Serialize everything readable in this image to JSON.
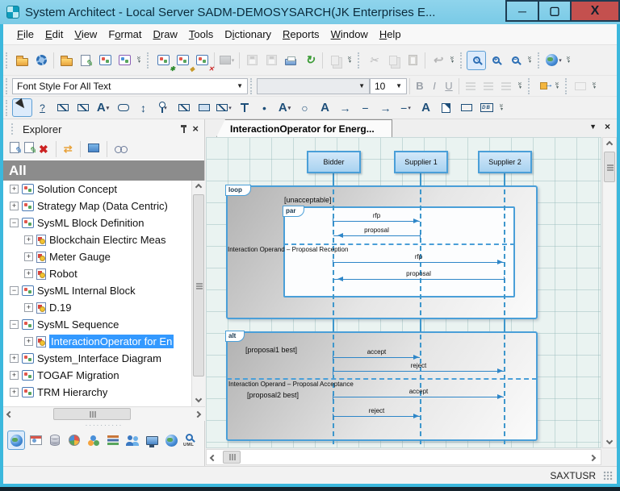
{
  "window": {
    "title": "System Architect - Local Server SADM-DEMOSYSARCH(JK Enterprises E..."
  },
  "menu_bar": {
    "items": [
      {
        "label": "File",
        "u": 0
      },
      {
        "label": "Edit",
        "u": 0
      },
      {
        "label": "View",
        "u": 0
      },
      {
        "label": "Format",
        "u": 1
      },
      {
        "label": "Draw",
        "u": 0
      },
      {
        "label": "Tools",
        "u": 0
      },
      {
        "label": "Dictionary",
        "u": 1
      },
      {
        "label": "Reports",
        "u": 0
      },
      {
        "label": "Window",
        "u": 0
      },
      {
        "label": "Help",
        "u": 0
      }
    ]
  },
  "toolbars": {
    "standard_icons": [
      "open",
      "options",
      "copy-definition",
      "edit-definition",
      "diagram-catalog",
      "diagram-grid"
    ],
    "diagram_icons": [
      "new-diagram",
      "add-diagram",
      "delete-diagram",
      "insert-image",
      "save",
      "save-all",
      "print",
      "refresh-diagram",
      "export-window"
    ],
    "edit_icons": [
      "cut",
      "copy",
      "paste",
      "undo"
    ],
    "zoom_icons": [
      "zoom-region",
      "zoom-in",
      "zoom-out"
    ],
    "web_icons": [
      "web-publish"
    ],
    "draw_icons": [
      "select-pointer",
      "comment",
      "shape-diagonal",
      "shape-diagonal-2",
      "text",
      "rounded-rect",
      "vertical-spacing",
      "lifeline",
      "shape",
      "rectangle",
      "shape-menu",
      "connector-pin",
      "point",
      "text-2",
      "ellipse",
      "text-3",
      "arrow-line",
      "line",
      "arrow-line-2",
      "line-menu",
      "text-4",
      "note",
      "rectangle-2",
      "database-symbol"
    ],
    "font_toolbar": {
      "style_value": "Font Style For All Text",
      "font_value": "",
      "size_value": "10",
      "bold": "B",
      "italic": "I",
      "underline": "U"
    }
  },
  "explorer": {
    "title": "Explorer",
    "toolbar_icons": [
      "new-definition",
      "edit-definition",
      "delete",
      "sync",
      "preview",
      "browse"
    ],
    "filter_header": "All",
    "tree": [
      {
        "label": "Solution Concept"
      },
      {
        "label": "Strategy Map (Data Centric)"
      },
      {
        "label": "SysML Block Definition"
      },
      {
        "label": "Blockchain Electirc Meas"
      },
      {
        "label": "Meter Gauge"
      },
      {
        "label": "Robot"
      },
      {
        "label": "SysML Internal Block"
      },
      {
        "label": "D.19"
      },
      {
        "label": "SysML Sequence"
      },
      {
        "label": "InteractionOperator for En"
      },
      {
        "label": "System_Interface Diagram"
      },
      {
        "label": "TOGAF Migration"
      },
      {
        "label": "TRM Hierarchy"
      }
    ],
    "bottom_toolbar_icons": [
      "all-view",
      "process-view",
      "data-view",
      "business-view",
      "object-view",
      "catalog-view",
      "users-view",
      "infrastructure-view",
      "web-view",
      "uml-search",
      "more-views"
    ]
  },
  "document": {
    "tab_title": "InteractionOperator for Energ..."
  },
  "diagram": {
    "lifelines": [
      {
        "name": "Bidder"
      },
      {
        "name": "Supplier 1"
      },
      {
        "name": "Supplier 2"
      }
    ],
    "loop": {
      "operator": "loop",
      "guard": "[unacceptable]",
      "par_operator": "par",
      "rfp1": "rfp",
      "proposal1": "proposal",
      "separator": "Interaction Operand – Proposal Reception",
      "rfp2": "rfp",
      "proposal2": "proposal"
    },
    "alt": {
      "operator": "alt",
      "guard1": "[proposal1 best]",
      "accept1": "accept",
      "reject1": "reject",
      "separator": "Interaction Operand  – Proposal Acceptance",
      "guard2": "[proposal2 best]",
      "accept2": "accept",
      "reject2": "reject"
    }
  },
  "status_bar": {
    "user": "SAXTUSR"
  },
  "colors": {
    "titlebar": "#79cae6",
    "window_border": "#3cb8dd",
    "close_button": "#c4504e",
    "selection": "#3399ff",
    "diagram_blue": "#4a9fd8",
    "canvas_bg": "#eaf3f1",
    "fragment_gray": "#b2b2b2"
  }
}
